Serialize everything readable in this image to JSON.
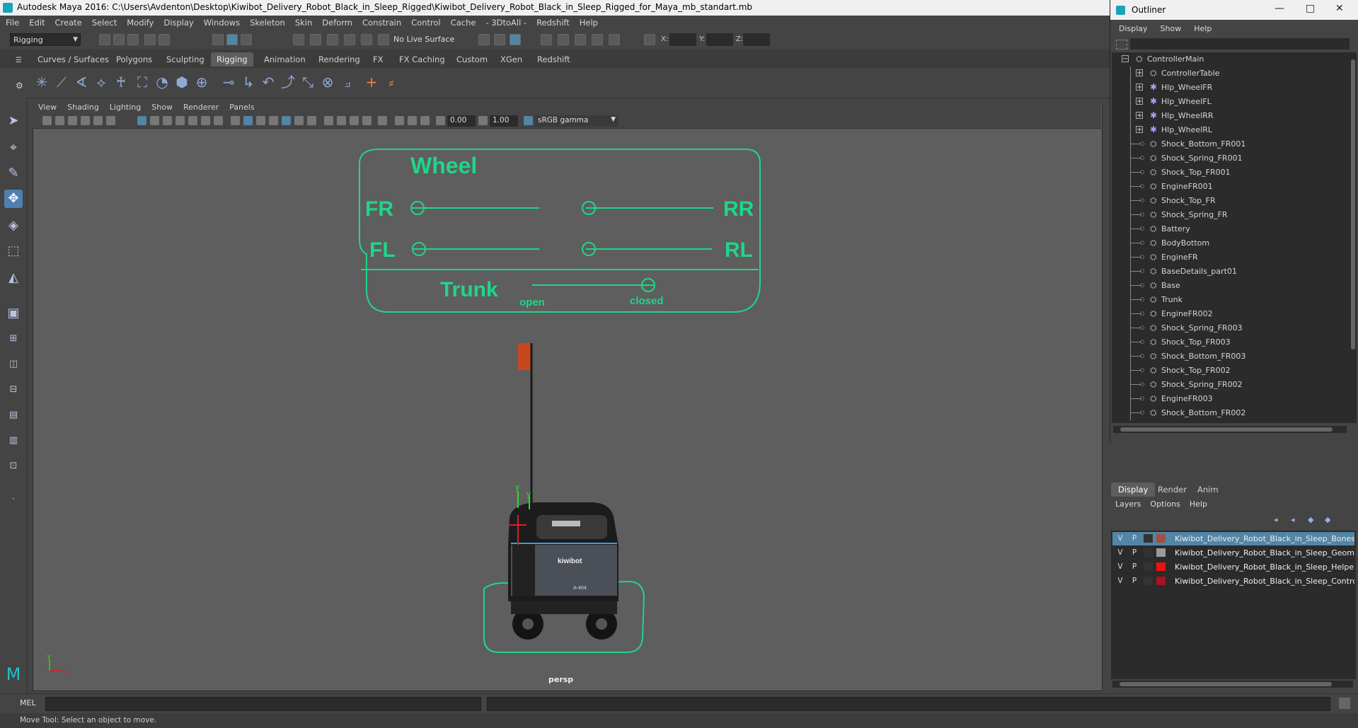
{
  "window": {
    "title": "Autodesk Maya 2016: C:\\Users\\Avdenton\\Desktop\\Kiwibot_Delivery_Robot_Black_in_Sleep_Rigged\\Kiwibot_Delivery_Robot_Black_in_Sleep_Rigged_for_Maya_mb_standart.mb"
  },
  "menubar": [
    "File",
    "Edit",
    "Create",
    "Select",
    "Modify",
    "Display",
    "Windows",
    "Skeleton",
    "Skin",
    "Deform",
    "Constrain",
    "Control",
    "Cache",
    "- 3DtoAll -",
    "Redshift",
    "Help"
  ],
  "statusline": {
    "menuset": "Rigging",
    "live_surface": "No Live Surface",
    "x_label": "X:",
    "y_label": "Y:",
    "z_label": "Z:"
  },
  "shelf_tabs": [
    "Curves / Surfaces",
    "Polygons",
    "Sculpting",
    "Rigging",
    "Animation",
    "Rendering",
    "FX",
    "FX Caching",
    "Custom",
    "XGen",
    "Redshift"
  ],
  "shelf_active": "Rigging",
  "viewport": {
    "menu": [
      "View",
      "Shading",
      "Lighting",
      "Show",
      "Renderer",
      "Panels"
    ],
    "exposure": "0.00",
    "gamma": "1.00",
    "color_space": "sRGB gamma",
    "camera_label": "persp",
    "axis_y": "y",
    "axis_x": "x"
  },
  "control_board": {
    "title": "Wheel",
    "fr": "FR",
    "fl": "FL",
    "rr": "RR",
    "rl": "RL",
    "trunk": "Trunk",
    "open": "open",
    "closed": "closed",
    "accent": "#1ed68a"
  },
  "robot": {
    "brand": "kiwibot",
    "id": "A-404",
    "axis_y1": "y",
    "axis_y2": "y"
  },
  "command_line": {
    "label": "MEL"
  },
  "help_line": {
    "text": "Move Tool: Select an object to move."
  },
  "outliner": {
    "title": "Outliner",
    "menu": [
      "Display",
      "Show",
      "Help"
    ],
    "items": [
      {
        "label": "ControllerMain",
        "type": "root"
      },
      {
        "label": "ControllerTable",
        "type": "group"
      },
      {
        "label": "Hlp_WheelFR",
        "type": "helper"
      },
      {
        "label": "Hlp_WheelFL",
        "type": "helper"
      },
      {
        "label": "Hlp_WheelRR",
        "type": "helper"
      },
      {
        "label": "Hlp_WheelRL",
        "type": "helper"
      },
      {
        "label": "Shock_Bottom_FR001",
        "type": "mesh"
      },
      {
        "label": "Shock_Spring_FR001",
        "type": "mesh"
      },
      {
        "label": "Shock_Top_FR001",
        "type": "mesh"
      },
      {
        "label": "EngineFR001",
        "type": "mesh"
      },
      {
        "label": "Shock_Top_FR",
        "type": "mesh"
      },
      {
        "label": "Shock_Spring_FR",
        "type": "mesh"
      },
      {
        "label": "Battery",
        "type": "mesh"
      },
      {
        "label": "BodyBottom",
        "type": "mesh"
      },
      {
        "label": "EngineFR",
        "type": "mesh"
      },
      {
        "label": "BaseDetails_part01",
        "type": "mesh"
      },
      {
        "label": "Base",
        "type": "mesh"
      },
      {
        "label": "Trunk",
        "type": "mesh"
      },
      {
        "label": "EngineFR002",
        "type": "mesh"
      },
      {
        "label": "Shock_Spring_FR003",
        "type": "mesh"
      },
      {
        "label": "Shock_Top_FR003",
        "type": "mesh"
      },
      {
        "label": "Shock_Bottom_FR003",
        "type": "mesh"
      },
      {
        "label": "Shock_Top_FR002",
        "type": "mesh"
      },
      {
        "label": "Shock_Spring_FR002",
        "type": "mesh"
      },
      {
        "label": "EngineFR003",
        "type": "mesh"
      },
      {
        "label": "Shock_Bottom_FR002",
        "type": "mesh"
      }
    ]
  },
  "layer_editor": {
    "tabs": [
      "Display",
      "Render",
      "Anim"
    ],
    "active_tab": "Display",
    "menu": [
      "Layers",
      "Options",
      "Help"
    ],
    "layers": [
      {
        "v": "V",
        "p": "P",
        "name": "Kiwibot_Delivery_Robot_Black_in_Sleep_Bones",
        "color": "#a0523e",
        "selected": true
      },
      {
        "v": "V",
        "p": "P",
        "name": "Kiwibot_Delivery_Robot_Black_in_Sleep_Geometry",
        "color": "#9a9a9a",
        "selected": false
      },
      {
        "v": "V",
        "p": "P",
        "name": "Kiwibot_Delivery_Robot_Black_in_Sleep_Helpers",
        "color": "#ee1111",
        "selected": false
      },
      {
        "v": "V",
        "p": "P",
        "name": "Kiwibot_Delivery_Robot_Black_in_Sleep_Controllers",
        "color": "#aa1122",
        "selected": false
      }
    ]
  }
}
